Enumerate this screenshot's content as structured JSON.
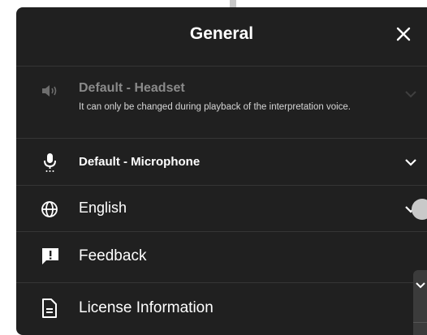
{
  "panel": {
    "title": "General",
    "close_icon": "close-icon"
  },
  "settings": {
    "speaker": {
      "label": "Default - Headset",
      "sub": "It can only be changed during playback of the interpretation voice.",
      "icon": "speaker-icon",
      "enabled": false
    },
    "microphone": {
      "label": "Default - Microphone",
      "icon": "microphone-icon"
    },
    "language": {
      "label": "English",
      "icon": "globe-icon"
    },
    "feedback": {
      "label": "Feedback",
      "icon": "feedback-icon"
    },
    "license": {
      "label": "License Information",
      "icon": "document-icon"
    }
  },
  "colors": {
    "panel_bg": "#202020",
    "divider": "#353535",
    "text": "#ffffff",
    "disabled_text": "#8a8a8a"
  }
}
